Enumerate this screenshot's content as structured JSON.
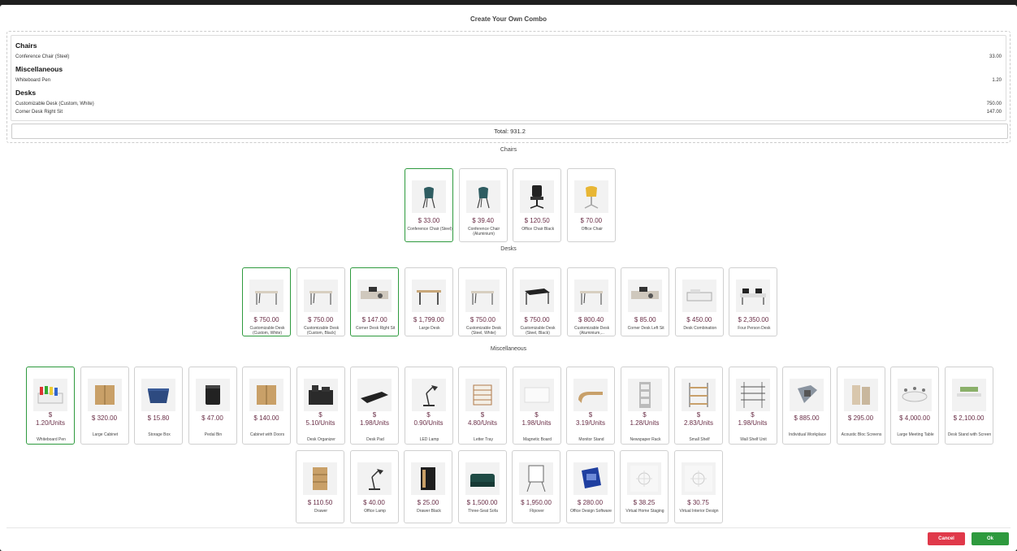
{
  "dialog": {
    "title": "Create Your Own Combo"
  },
  "summary": {
    "groups": [
      {
        "name": "Chairs",
        "lines": [
          {
            "item": "Conference Chair (Steel)",
            "price": "33.00"
          }
        ]
      },
      {
        "name": "Miscellaneous",
        "lines": [
          {
            "item": "Whiteboard Pen",
            "price": "1.20"
          }
        ]
      },
      {
        "name": "Desks",
        "lines": [
          {
            "item": "Customizable Desk (Custom, White)",
            "price": "750.00"
          },
          {
            "item": "Corner Desk Right Sit",
            "price": "147.00"
          }
        ]
      }
    ],
    "total": "Total: 931.2"
  },
  "sections": {
    "chairs": "Chairs",
    "desks": "Desks",
    "misc": "Miscellaneous"
  },
  "chairs": [
    {
      "price": "$ 33.00",
      "name": "Conference Chair (Steel)",
      "icon": "teal-chair-icon",
      "selected": true
    },
    {
      "price": "$ 39.40",
      "name": "Conference Chair (Aluminium)",
      "icon": "teal-chair-icon",
      "selected": false
    },
    {
      "price": "$ 120.50",
      "name": "Office Chair Black",
      "icon": "office-chair-icon",
      "selected": false
    },
    {
      "price": "$ 70.00",
      "name": "Office Chair",
      "icon": "yellow-chair-icon",
      "selected": false
    }
  ],
  "desks": [
    {
      "price": "$ 750.00",
      "name": "Customizable Desk (Custom, White)",
      "icon": "desk-icon",
      "selected": true
    },
    {
      "price": "$ 750.00",
      "name": "Customizable Desk (Custom, Black)",
      "icon": "desk-icon",
      "selected": false
    },
    {
      "price": "$ 147.00",
      "name": "Corner Desk Right Sit",
      "icon": "corner-desk-icon",
      "selected": true
    },
    {
      "price": "$ 1,799.00",
      "name": "Large Desk",
      "icon": "large-desk-icon",
      "selected": false
    },
    {
      "price": "$ 750.00",
      "name": "Customizable Desk (Steel, White)",
      "icon": "desk-icon",
      "selected": false
    },
    {
      "price": "$ 750.00",
      "name": "Customizable Desk (Steel, Black)",
      "icon": "black-desk-icon",
      "selected": false
    },
    {
      "price": "$ 800.40",
      "name": "Customizable Desk (Aluminium,...",
      "icon": "desk-icon",
      "selected": false
    },
    {
      "price": "$ 85.00",
      "name": "Corner Desk Left Sit",
      "icon": "corner-desk-icon",
      "selected": false
    },
    {
      "price": "$ 450.00",
      "name": "Desk Combination",
      "icon": "desk-combo-icon",
      "selected": false
    },
    {
      "price": "$ 2,350.00",
      "name": "Four Person Desk",
      "icon": "four-desk-icon",
      "selected": false
    }
  ],
  "misc_row1": [
    {
      "price": "$\n1.20/Units",
      "name": "Whiteboard Pen",
      "icon": "pens-icon",
      "selected": true
    },
    {
      "price": "$ 320.00",
      "name": "Large Cabinet",
      "icon": "cabinet-icon",
      "selected": false
    },
    {
      "price": "$ 15.80",
      "name": "Storage Box",
      "icon": "storage-box-icon",
      "selected": false
    },
    {
      "price": "$ 47.00",
      "name": "Pedal Bin",
      "icon": "bin-icon",
      "selected": false
    },
    {
      "price": "$ 140.00",
      "name": "Cabinet with Doors",
      "icon": "cabinet-icon",
      "selected": false
    },
    {
      "price": "$\n5.10/Units",
      "name": "Desk Organizer",
      "icon": "organizer-icon",
      "selected": false
    },
    {
      "price": "$\n1.98/Units",
      "name": "Desk Pad",
      "icon": "desk-pad-icon",
      "selected": false
    },
    {
      "price": "$\n0.90/Units",
      "name": "LED Lamp",
      "icon": "lamp-icon",
      "selected": false
    },
    {
      "price": "$\n4.80/Units",
      "name": "Letter Tray",
      "icon": "letter-tray-icon",
      "selected": false
    },
    {
      "price": "$\n1.98/Units",
      "name": "Magnetic Board",
      "icon": "board-icon",
      "selected": false
    },
    {
      "price": "$\n3.19/Units",
      "name": "Monitor Stand",
      "icon": "monitor-stand-icon",
      "selected": false
    },
    {
      "price": "$\n1.28/Units",
      "name": "Newspaper Rack",
      "icon": "rack-icon",
      "selected": false
    },
    {
      "price": "$\n2.83/Units",
      "name": "Small Shelf",
      "icon": "shelf-icon",
      "selected": false
    },
    {
      "price": "$\n1.98/Units",
      "name": "Wall Shelf Unit",
      "icon": "wall-shelf-icon",
      "selected": false
    },
    {
      "price": "$ 885.00",
      "name": "Individual Workplace",
      "icon": "workplace-icon",
      "selected": false
    },
    {
      "price": "$ 295.00",
      "name": "Acoustic Bloc Screens",
      "icon": "screens-icon",
      "selected": false
    },
    {
      "price": "$ 4,000.00",
      "name": "Large Meeting Table",
      "icon": "meeting-table-icon",
      "selected": false
    },
    {
      "price": "$ 2,100.00",
      "name": "Desk Stand with Screen",
      "icon": "desk-stand-icon",
      "selected": false
    }
  ],
  "misc_row2": [
    {
      "price": "$ 110.50",
      "name": "Drawer",
      "icon": "drawer-icon",
      "selected": false
    },
    {
      "price": "$ 40.00",
      "name": "Office Lamp",
      "icon": "lamp-icon",
      "selected": false
    },
    {
      "price": "$ 25.00",
      "name": "Drawer Black",
      "icon": "drawer-black-icon",
      "selected": false
    },
    {
      "price": "$ 1,500.00",
      "name": "Three-Seat Sofa",
      "icon": "sofa-icon",
      "selected": false
    },
    {
      "price": "$ 1,950.00",
      "name": "Flipover",
      "icon": "flipover-icon",
      "selected": false
    },
    {
      "price": "$ 280.00",
      "name": "Office Design Software",
      "icon": "software-icon",
      "selected": false
    },
    {
      "price": "$ 38.25",
      "name": "Virtual Home Staging",
      "icon": "virtual-icon",
      "selected": false
    },
    {
      "price": "$ 30.75",
      "name": "Virtual Interior Design",
      "icon": "virtual-icon",
      "selected": false
    }
  ],
  "buttons": {
    "cancel": "Cancel",
    "ok": "Ok"
  },
  "colors": {
    "selected_border": "#2e9a3e",
    "price": "#6a2f47",
    "cancel": "#e0394a",
    "ok": "#2e9a3e"
  }
}
